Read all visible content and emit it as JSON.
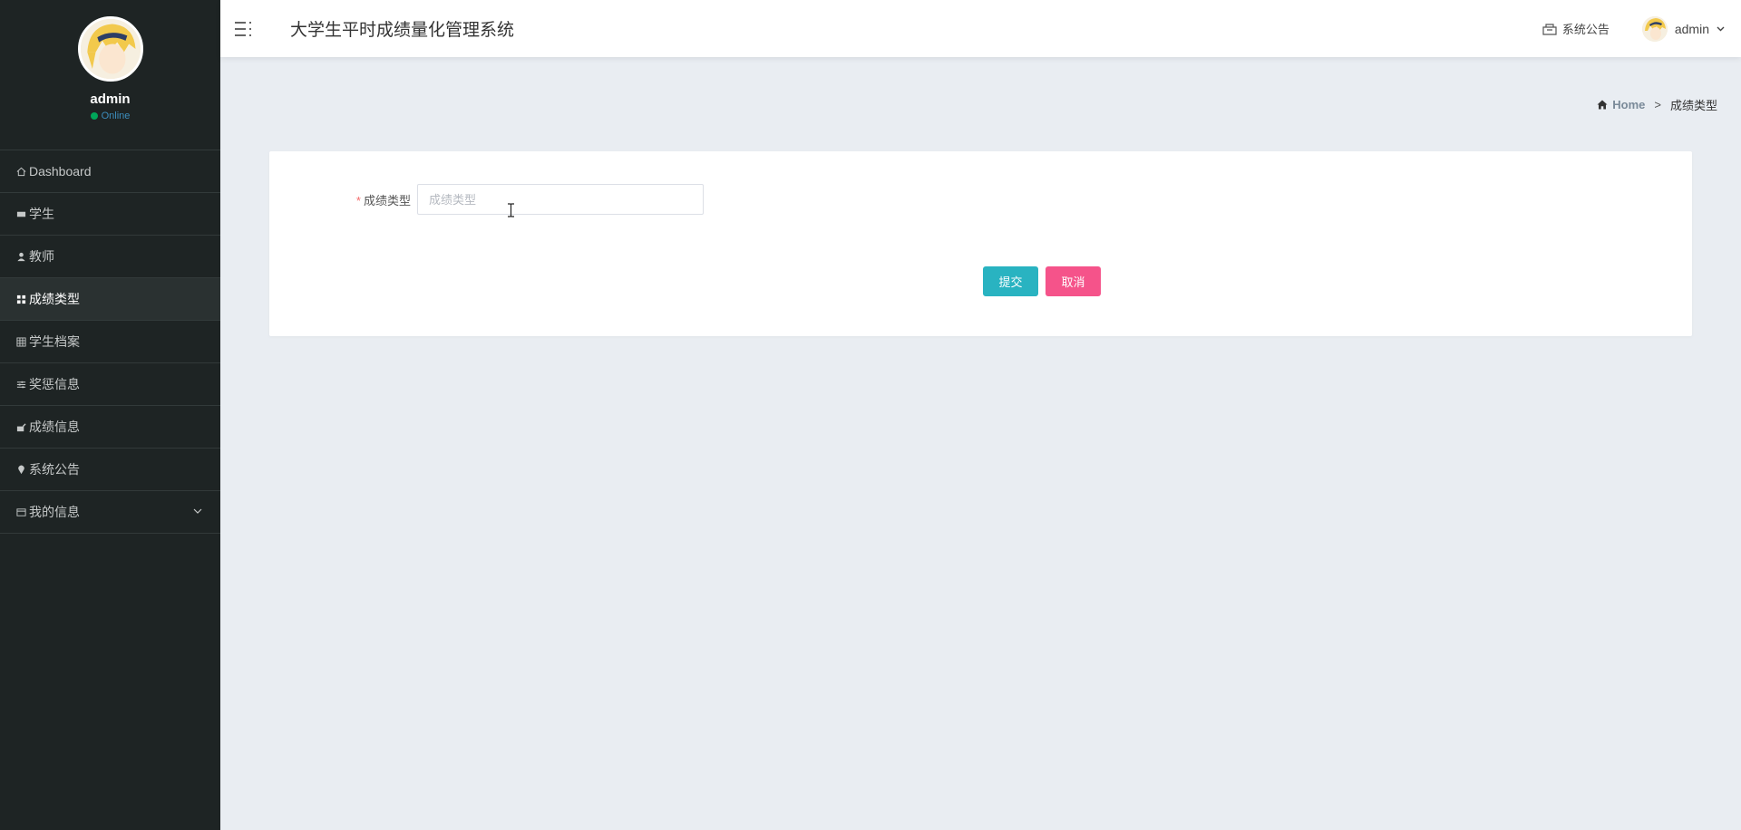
{
  "sidebar": {
    "user": {
      "name": "admin",
      "status": "Online"
    },
    "items": [
      {
        "label": "Dashboard",
        "icon": "home-icon"
      },
      {
        "label": "学生",
        "icon": "id-card-icon"
      },
      {
        "label": "教师",
        "icon": "user-icon"
      },
      {
        "label": "成绩类型",
        "icon": "grid-icon",
        "active": true
      },
      {
        "label": "学生档案",
        "icon": "table-icon"
      },
      {
        "label": "奖惩信息",
        "icon": "sliders-icon"
      },
      {
        "label": "成绩信息",
        "icon": "chart-icon"
      },
      {
        "label": "系统公告",
        "icon": "pin-icon"
      },
      {
        "label": "我的信息",
        "icon": "profile-card-icon",
        "expandable": true
      }
    ]
  },
  "header": {
    "title": "大学生平时成绩量化管理系统",
    "notice_label": "系统公告",
    "user_label": "admin"
  },
  "breadcrumb": {
    "home": "Home",
    "separator": ">",
    "current": "成绩类型"
  },
  "form": {
    "field": {
      "required_mark": "*",
      "label": "成绩类型",
      "value": "",
      "placeholder": "成绩类型"
    },
    "submit_label": "提交",
    "cancel_label": "取消"
  },
  "colors": {
    "sidebar_bg": "#1e2424",
    "content_bg": "#e9edf2",
    "submit": "#29b3c1",
    "cancel": "#f5538a",
    "online": "#00a65a",
    "required": "#f56c6c"
  }
}
